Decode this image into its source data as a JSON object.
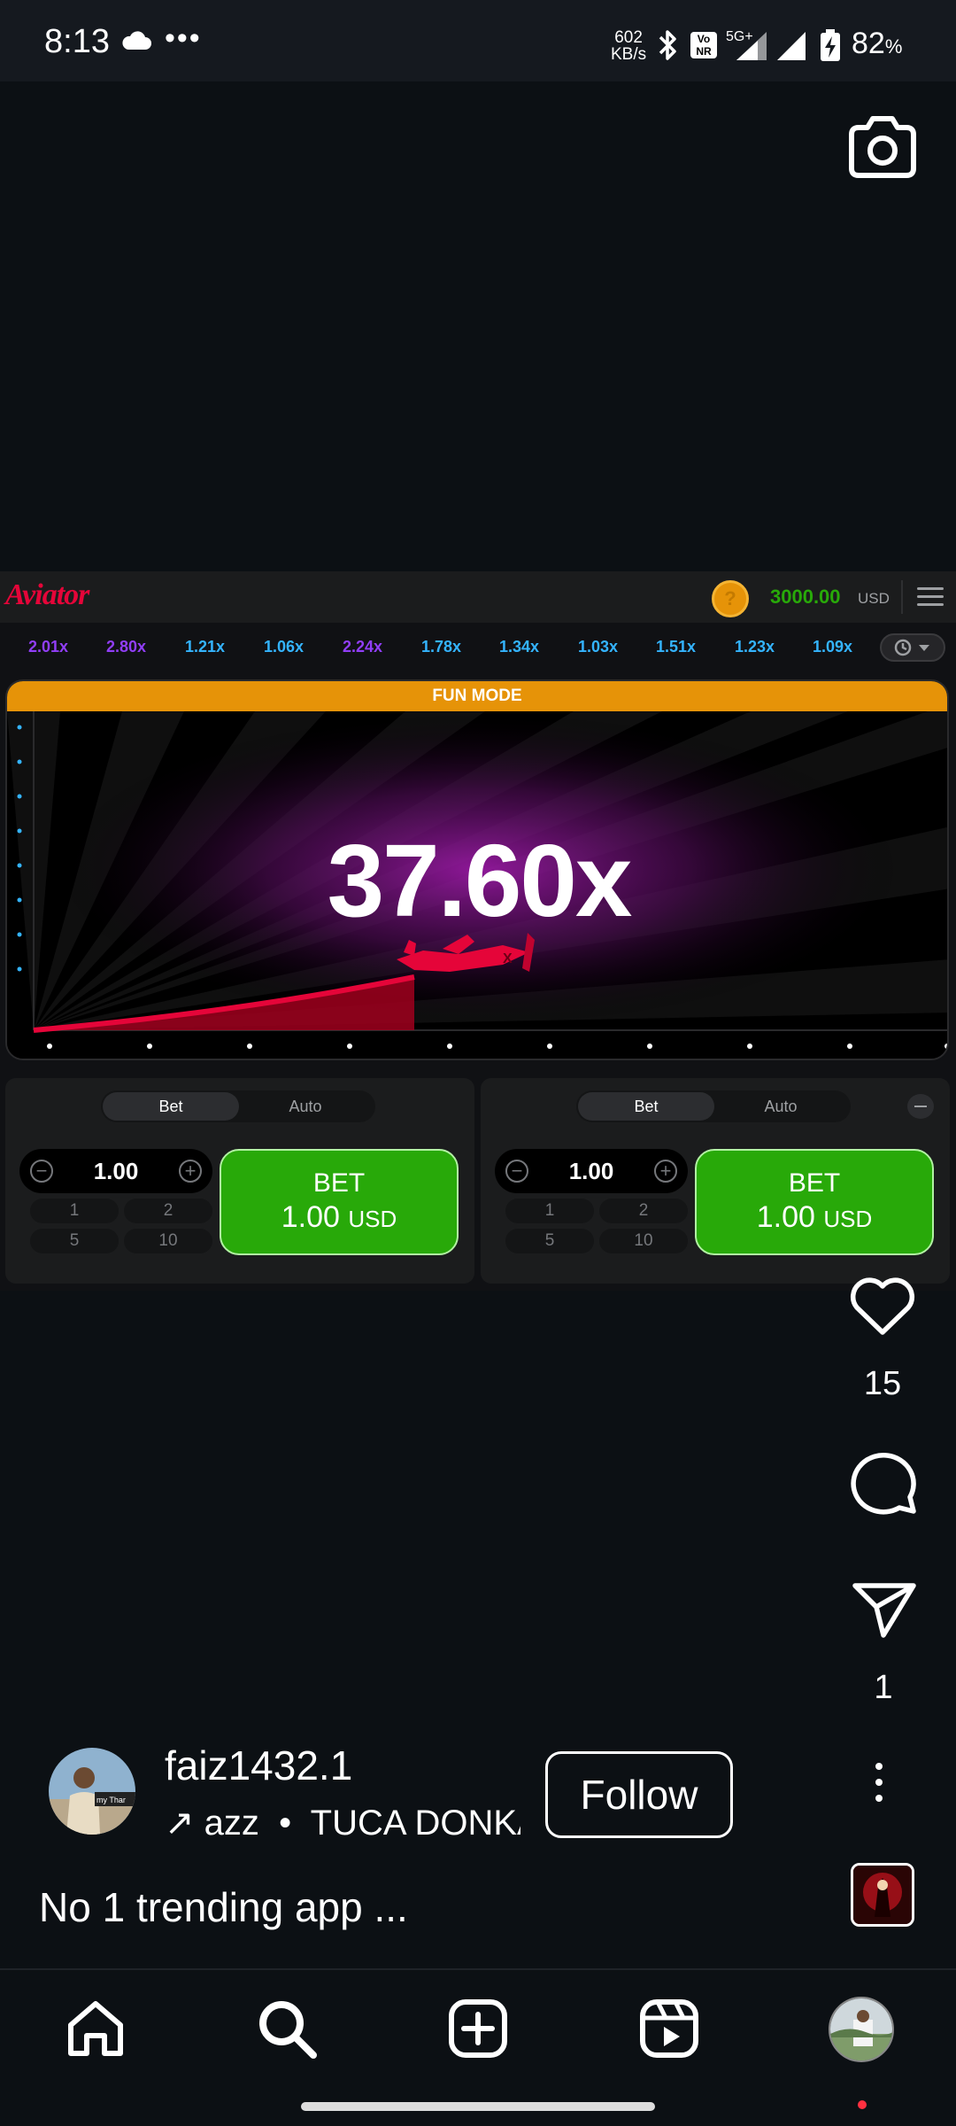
{
  "status_bar": {
    "time": "8:13",
    "dots": "•••",
    "net_speed_value": "602",
    "net_speed_unit": "KB/s",
    "volte": "Vo\nNR",
    "network": "5G+",
    "battery": "82",
    "battery_unit": "%"
  },
  "game": {
    "logo": "Aviator",
    "coin_symbol": "?",
    "balance": "3000.00",
    "currency": "USD",
    "history": [
      {
        "value": "2.01x",
        "color": "#913ef8"
      },
      {
        "value": "2.80x",
        "color": "#913ef8"
      },
      {
        "value": "1.21x",
        "color": "#34b4ff"
      },
      {
        "value": "1.06x",
        "color": "#34b4ff"
      },
      {
        "value": "2.24x",
        "color": "#913ef8"
      },
      {
        "value": "1.78x",
        "color": "#34b4ff"
      },
      {
        "value": "1.34x",
        "color": "#34b4ff"
      },
      {
        "value": "1.03x",
        "color": "#34b4ff"
      },
      {
        "value": "1.51x",
        "color": "#34b4ff"
      },
      {
        "value": "1.23x",
        "color": "#34b4ff"
      },
      {
        "value": "1.09x",
        "color": "#34b4ff"
      }
    ],
    "mode_banner": "FUN MODE",
    "multiplier": "37.60x",
    "accent_colors": {
      "plane": "#e50539",
      "bet_green": "#28a909",
      "fun_orange": "#e69308"
    },
    "panels": [
      {
        "tab_bet": "Bet",
        "tab_auto": "Auto",
        "amount": "1.00",
        "quick": [
          "1",
          "2",
          "5",
          "10"
        ],
        "bet_label": "BET",
        "bet_amount": "1.00",
        "bet_currency": "USD"
      },
      {
        "tab_bet": "Bet",
        "tab_auto": "Auto",
        "amount": "1.00",
        "quick": [
          "1",
          "2",
          "5",
          "10"
        ],
        "bet_label": "BET",
        "bet_amount": "1.00",
        "bet_currency": "USD"
      }
    ]
  },
  "reel": {
    "likes": "15",
    "shares": "1",
    "username": "faiz1432.1",
    "audio_arrow": "↗",
    "audio_prefix": "azz",
    "audio_sep": "•",
    "audio_track": "TUCA DONKA",
    "follow_label": "Follow",
    "caption": "No 1 trending app ...",
    "avatar_text": "my Thar"
  },
  "icons": {
    "camera": "camera-icon",
    "like": "heart-icon",
    "comment": "comment-icon",
    "share": "send-icon",
    "more": "more-vertical-icon",
    "home": "home-icon",
    "search": "search-icon",
    "create": "plus-square-icon",
    "reels": "reels-icon"
  }
}
